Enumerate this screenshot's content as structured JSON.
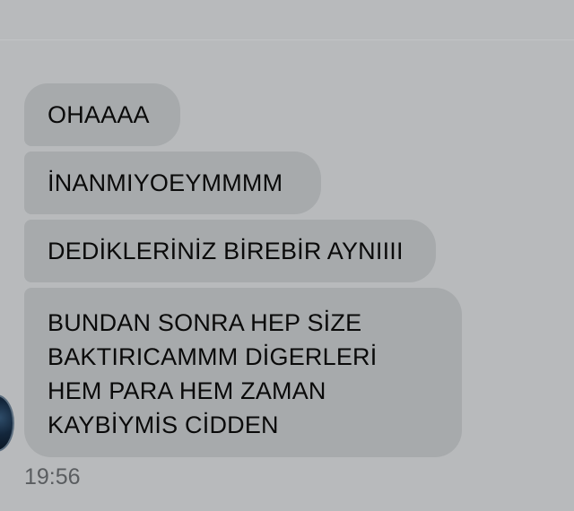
{
  "conversation": {
    "messages": [
      {
        "lines": [
          "OHAAAA"
        ]
      },
      {
        "lines": [
          "İNANMIYOEYMMMM"
        ]
      },
      {
        "lines": [
          "DEDİKLERİNİZ BİREBİR AYNIIII"
        ]
      },
      {
        "lines": [
          "BUNDAN SONRA HEP SİZE",
          "BAKTIRICAMMM DİGERLERİ",
          "HEM PARA HEM ZAMAN",
          "KAYBİYMİS CİDDEN"
        ]
      }
    ],
    "timestamp": "19:56"
  },
  "colors": {
    "background": "#b8babc",
    "bubble": "#a7aaac",
    "text": "#0a0a0a",
    "timestamp": "#5a5d60"
  }
}
